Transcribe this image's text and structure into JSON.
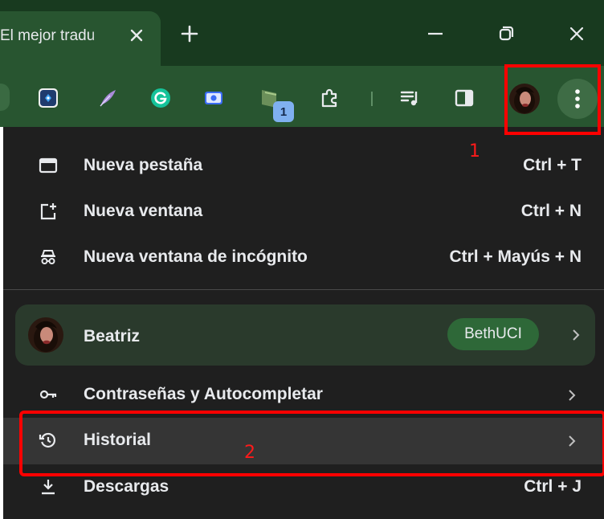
{
  "window": {
    "tab_title": "El mejor tradu",
    "new_tab_symbol": "+",
    "colors": {
      "titlebar": "#183a1f",
      "toolbar": "#285530",
      "menu": "#1f1f1f",
      "annotation": "#ff0000"
    }
  },
  "toolbar": {
    "extensions": [
      {
        "name": "translator-extension-icon"
      },
      {
        "name": "feather-extension-icon"
      },
      {
        "name": "grammarly-icon"
      },
      {
        "name": "screen-recorder-icon"
      },
      {
        "name": "extension-with-badge-icon",
        "badge": "1"
      },
      {
        "name": "puzzle-extensions-icon"
      },
      {
        "name": "reading-list-icon"
      },
      {
        "name": "side-panel-icon"
      }
    ],
    "profile_avatar": "avatar",
    "menu_icon": "three-dot-menu-icon"
  },
  "menu": {
    "items_top": [
      {
        "icon": "new-tab-icon",
        "label": "Nueva pestaña",
        "shortcut": "Ctrl + T"
      },
      {
        "icon": "new-window-icon",
        "label": "Nueva ventana",
        "shortcut": "Ctrl + N"
      },
      {
        "icon": "incognito-icon",
        "label": "Nueva ventana de incógnito",
        "shortcut": "Ctrl + Mayús + N"
      }
    ],
    "profile": {
      "name": "Beatriz",
      "account_chip": "BethUCI"
    },
    "items_bottom": [
      {
        "icon": "key-icon",
        "label": "Contraseñas y Autocompletar"
      },
      {
        "icon": "history-icon",
        "label": "Historial"
      },
      {
        "icon": "download-icon",
        "label": "Descargas",
        "shortcut": "Ctrl + J"
      }
    ]
  },
  "annotations": {
    "label_1": "1",
    "label_2": "2"
  }
}
